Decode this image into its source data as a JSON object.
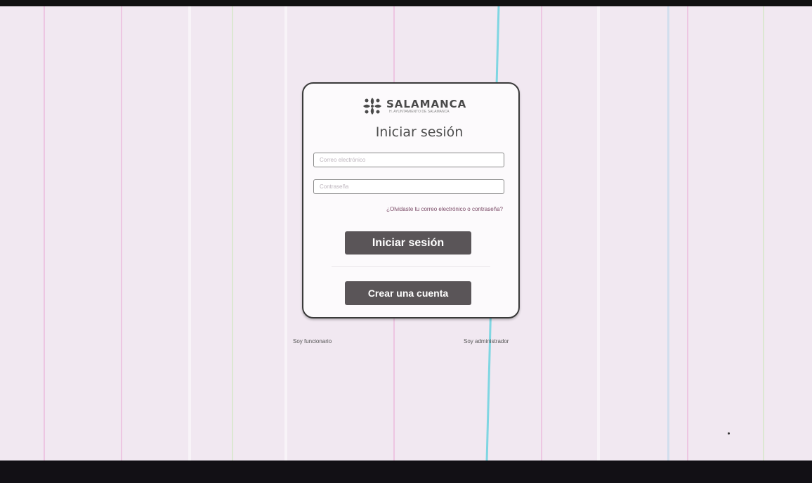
{
  "brand": {
    "name": "SALAMANCA",
    "tagline": "H. AYUNTAMIENTO DE SALAMANCA",
    "logo_icon": "flower-logo-icon",
    "colors": {
      "background": "#f1e8f1",
      "button": "#5a5558",
      "link": "#7a4a66"
    }
  },
  "login": {
    "title": "Iniciar sesión",
    "email_placeholder": "Correo electrónico",
    "password_placeholder": "Contraseña",
    "forgot_link": "¿Olvidaste tu correo electrónico o contraseña?",
    "submit_label": "Iniciar sesión",
    "create_account_label": "Crear una cuenta"
  },
  "footer": {
    "left_link": "Soy funcionario",
    "right_link": "Soy administrador"
  }
}
